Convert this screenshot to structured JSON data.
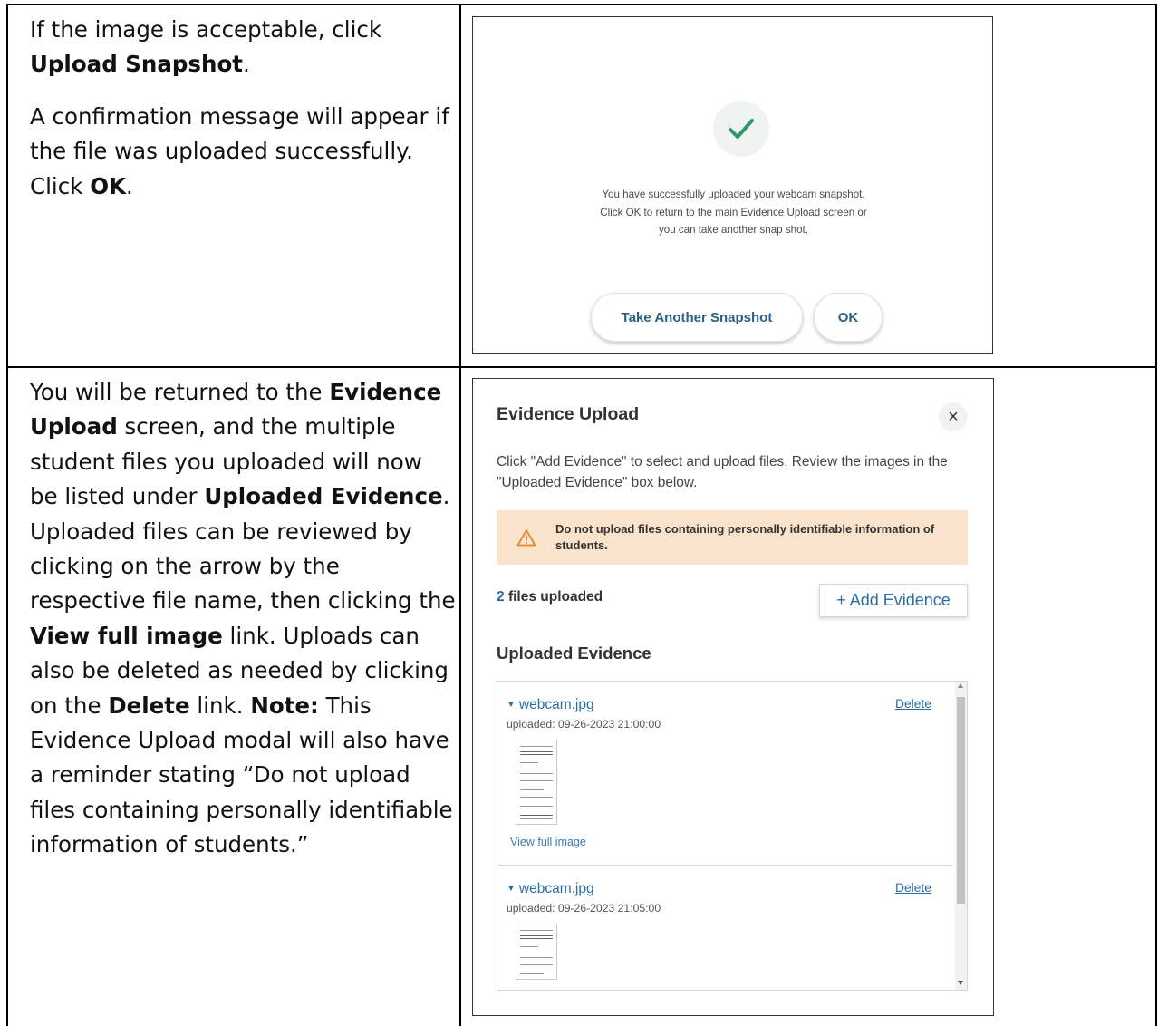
{
  "instructions": {
    "row1": {
      "p1_before": "If the image is acceptable, click",
      "p1_bold": "Upload Snapshot",
      "p1_after": ".",
      "p2_text": "A confirmation message will appear if the file was uploaded successfully. Click",
      "p2_bold": "OK",
      "p2_after": "."
    },
    "row2": {
      "t1": "You will be returned to the",
      "b1": "Evidence Upload",
      "t2": "screen, and the multiple student files you uploaded will now be listed under",
      "b2": "Uploaded Evidence",
      "t3": ". Uploaded files can be reviewed by clicking on the arrow by the respective file name, then clicking the",
      "b3": "View full image",
      "t4": "link. Uploads can also be deleted as needed by clicking on the",
      "b4": "Delete",
      "t5": "link.",
      "b5": "Note:",
      "t6": "This Evidence Upload modal will also have a reminder stating “Do not upload files containing personally identifiable information of students.”"
    }
  },
  "confirmation_dialog": {
    "icon": "checkmark-icon",
    "line1": "You have successfully uploaded your webcam snapshot.",
    "line2": "Click OK to return to the main Evidence Upload screen or",
    "line3": "you can take another snap shot.",
    "take_another_label": "Take Another Snapshot",
    "ok_label": "OK",
    "check_color": "#2e9a6a"
  },
  "evidence_modal": {
    "title": "Evidence Upload",
    "close_glyph": "×",
    "description": "Click \"Add Evidence\" to select and upload files. Review the images in the \"Uploaded Evidence\" box below.",
    "warning": "Do not upload files containing personally identifiable information of students.",
    "files_count_num": "2",
    "files_count_text": "files uploaded",
    "add_button": "+ Add Evidence",
    "uploaded_heading": "Uploaded Evidence",
    "files": [
      {
        "name": "webcam.jpg",
        "uploaded": "uploaded: 09-26-2023 21:00:00",
        "delete_label": "Delete",
        "view_label": "View full image"
      },
      {
        "name": "webcam.jpg",
        "uploaded": "uploaded: 09-26-2023 21:05:00",
        "delete_label": "Delete"
      }
    ],
    "link_color": "#2a6ca8",
    "warning_bg": "#fae3cc"
  }
}
